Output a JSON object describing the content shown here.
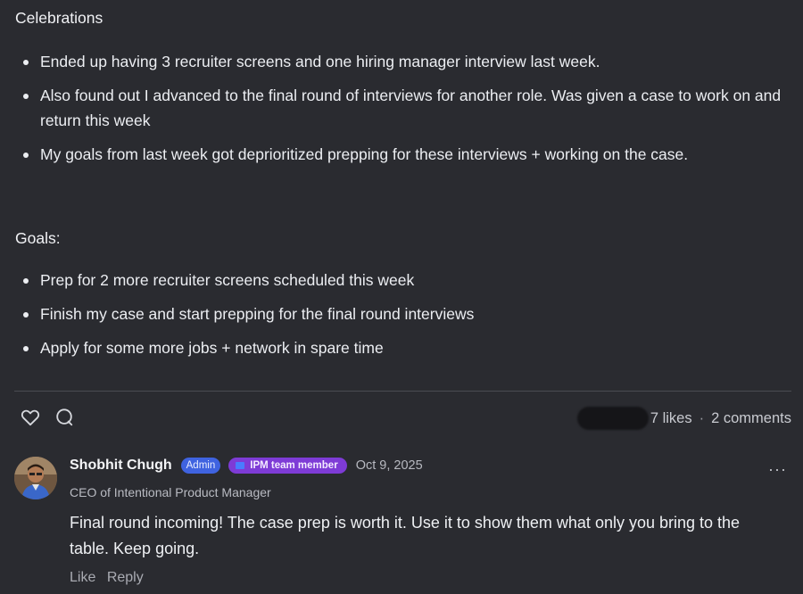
{
  "post": {
    "celebrations_heading": "Celebrations",
    "celebrations": [
      "Ended up having 3 recruiter screens and one hiring manager interview last week.",
      "Also found out I advanced to the final round of interviews for another role. Was given a case to work on and return this week",
      "My goals from last week got deprioritized prepping for these interviews + working on the case."
    ],
    "goals_heading": "Goals:",
    "goals": [
      "Prep for 2 more recruiter screens scheduled this week",
      "Finish my case and start prepping for the final round interviews",
      "Apply for some more jobs + network in spare time"
    ]
  },
  "actions": {
    "like_icon": "heart-icon",
    "comment_icon": "comment-bubble-icon",
    "likes_text": "7 likes",
    "separator": "·",
    "comments_text": "2 comments"
  },
  "comment": {
    "author": "Shobhit Chugh",
    "admin_badge": "Admin",
    "team_badge": "IPM team member",
    "date": "Oct 9, 2025",
    "author_title": "CEO of Intentional Product Manager",
    "body": "Final round incoming! The case prep is worth it. Use it to show them what only you bring to the table. Keep going.",
    "like_label": "Like",
    "reply_label": "Reply",
    "more_icon": "ellipsis-icon"
  },
  "colors": {
    "background": "#2a2b30",
    "admin_badge": "#3f63e0",
    "team_badge": "#7e3bd6"
  }
}
